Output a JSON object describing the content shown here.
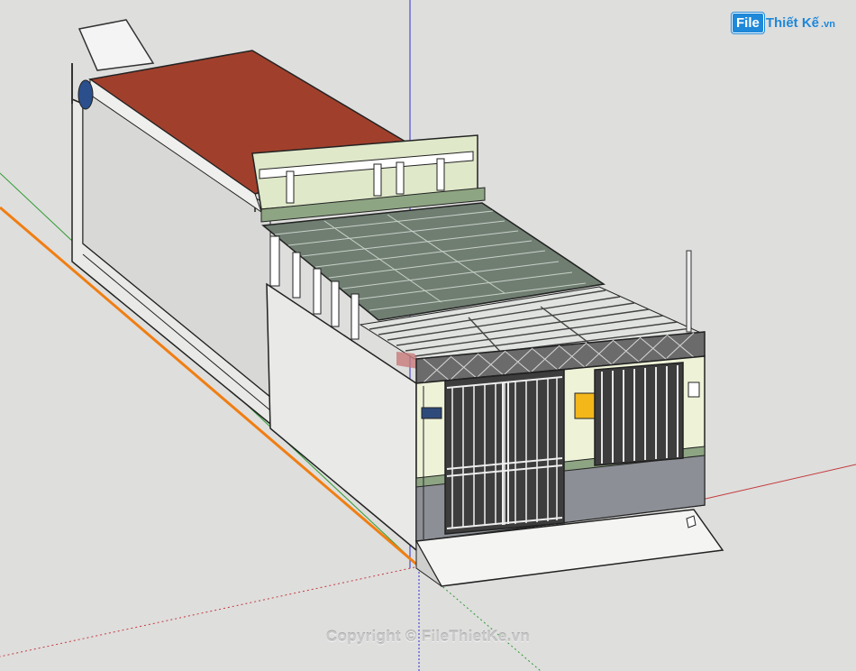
{
  "watermark": {
    "logo_badge": "File",
    "logo_text": "Thiết Kế",
    "logo_tld": ".vn",
    "copyright": "Copyright © FileThietKe.vn"
  },
  "colors": {
    "background": "#dededd",
    "roof_tile": "#a0402c",
    "wall": "#ececea",
    "trim": "#dfe8c9",
    "accent_green": "#8ea583",
    "metal_roof": "#6f7e71",
    "gate": "#5a5a5a",
    "mailbox": "#f3b71a",
    "brick": "#8c8f95",
    "axis_red": "#c43c3c",
    "axis_green": "#2e9b2e",
    "axis_blue": "#2d2dd6",
    "axis_orange": "#f07e12"
  },
  "icons": {
    "brand": "filethietke-logo",
    "model": "house-3d-model"
  }
}
